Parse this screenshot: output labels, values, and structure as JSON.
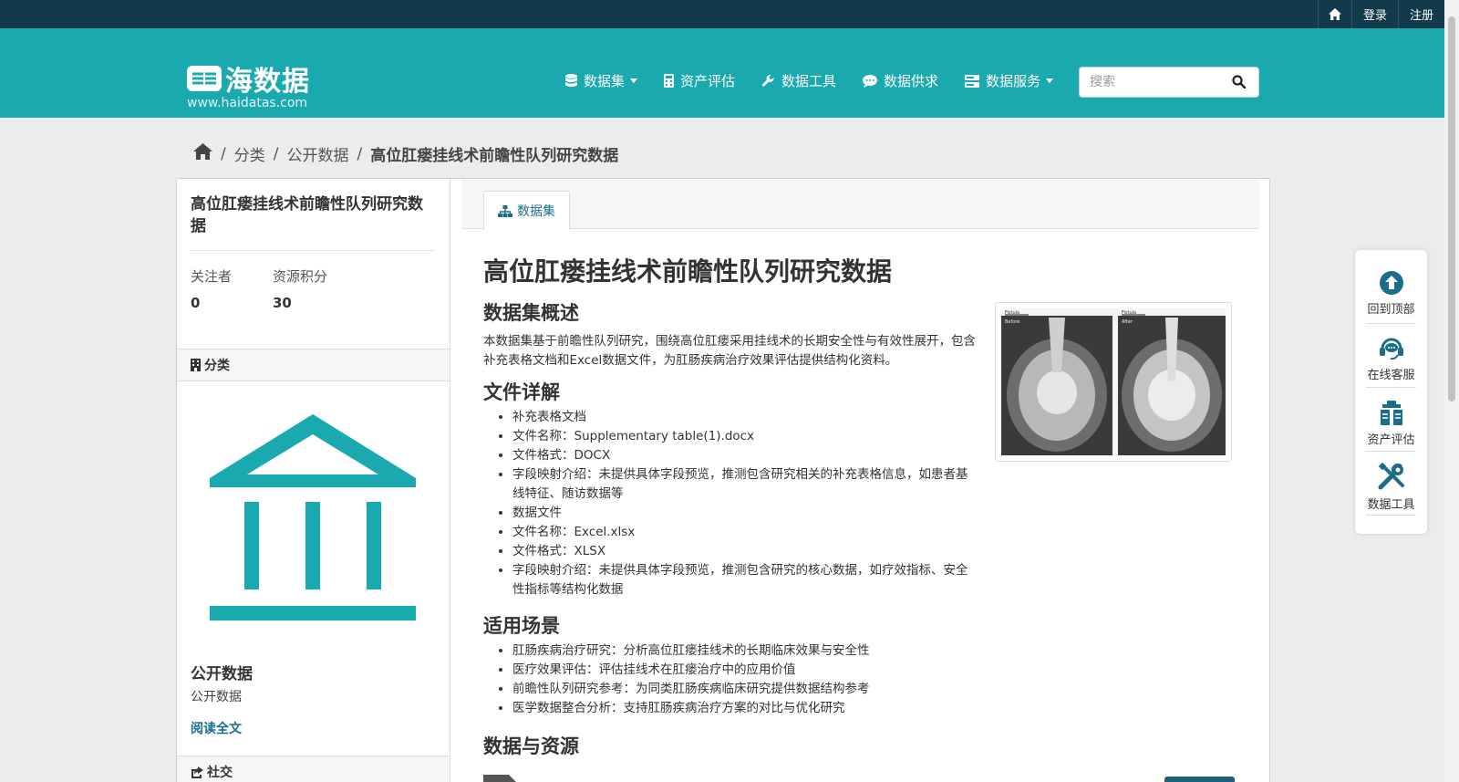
{
  "topbar": {
    "login": "登录",
    "register": "注册"
  },
  "header": {
    "logo_text": "海数据",
    "logo_url": "www.haidatas.com",
    "nav": [
      {
        "label": "数据集",
        "icon": "database-icon",
        "dropdown": true
      },
      {
        "label": "资产评估",
        "icon": "calculator-icon",
        "dropdown": false
      },
      {
        "label": "数据工具",
        "icon": "wrench-icon",
        "dropdown": false
      },
      {
        "label": "数据供求",
        "icon": "comment-icon",
        "dropdown": false
      },
      {
        "label": "数据服务",
        "icon": "server-icon",
        "dropdown": true
      }
    ],
    "search_placeholder": "搜索"
  },
  "breadcrumb": {
    "items": [
      "分类",
      "公开数据"
    ],
    "current": "高位肛瘘挂线术前瞻性队列研究数据"
  },
  "sidebar": {
    "title": "高位肛瘘挂线术前瞻性队列研究数据",
    "followers_label": "关注者",
    "followers": "0",
    "points_label": "资源积分",
    "points": "30",
    "category_header": "分类",
    "org_name": "公开数据",
    "org_desc": "公开数据",
    "read_more": "阅读全文",
    "social_header": "社交"
  },
  "content": {
    "tab": "数据集",
    "title": "高位肛瘘挂线术前瞻性队列研究数据",
    "overview_heading": "数据集概述",
    "overview_text": "本数据集基于前瞻性队列研究，围绕高位肛瘘采用挂线术的长期安全性与有效性展开，包含补充表格文档和Excel数据文件，为肛肠疾病治疗效果评估提供结构化资料。",
    "files_heading": "文件详解",
    "files": [
      "补充表格文档",
      "文件名称：Supplementary table(1).docx",
      "文件格式：DOCX",
      "字段映射介绍：未提供具体字段预览，推测包含研究相关的补充表格信息，如患者基线特征、随访数据等",
      "数据文件",
      "文件名称：Excel.xlsx",
      "文件格式：XLSX",
      "字段映射介绍：未提供具体字段预览，推测包含研究的核心数据，如疗效指标、安全性指标等结构化数据"
    ],
    "scenarios_heading": "适用场景",
    "scenarios": [
      "肛肠疾病治疗研究：分析高位肛瘘挂线术的长期临床效果与安全性",
      "医疗效果评估：评估挂线术在肛瘘治疗中的应用价值",
      "前瞻性队列研究参考：为同类肛肠疾病临床研究提供数据结构参考",
      "医学数据整合分析：支持肛肠疾病治疗方案的对比与优化研究"
    ],
    "resources_heading": "数据与资源",
    "thumb_labels": [
      "Fistula",
      "Fistula",
      "Before",
      "After"
    ]
  },
  "float_bar": [
    {
      "label": "回到顶部",
      "icon": "arrow-up-circle-icon"
    },
    {
      "label": "在线客服",
      "icon": "headset-icon"
    },
    {
      "label": "资产评估",
      "icon": "clipboard-icon"
    },
    {
      "label": "数据工具",
      "icon": "tools-icon"
    }
  ],
  "colors": {
    "topbar": "#133a4b",
    "brand": "#1aa9ae",
    "link": "#1a6e8c"
  }
}
